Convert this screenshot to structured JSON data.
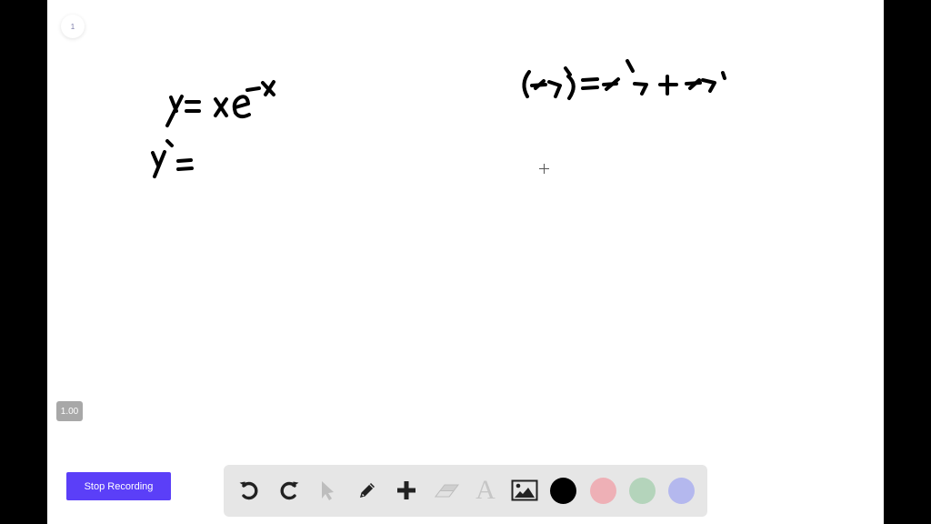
{
  "page": {
    "number": "1"
  },
  "zoom": {
    "level": "1.00"
  },
  "recording": {
    "stop_label": "Stop Recording"
  },
  "toolbar": {
    "tools": [
      {
        "name": "undo",
        "icon": "undo-icon",
        "enabled": true
      },
      {
        "name": "redo",
        "icon": "redo-icon",
        "enabled": true
      },
      {
        "name": "select",
        "icon": "cursor-arrow-icon",
        "enabled": false
      },
      {
        "name": "pen",
        "icon": "pencil-icon",
        "enabled": true
      },
      {
        "name": "add",
        "icon": "plus-icon",
        "enabled": true
      },
      {
        "name": "eraser",
        "icon": "eraser-icon",
        "enabled": false
      },
      {
        "name": "text",
        "icon": "text-icon",
        "label": "A",
        "enabled": false
      },
      {
        "name": "image",
        "icon": "image-icon",
        "enabled": true
      }
    ],
    "colors": [
      {
        "name": "black",
        "hex": "#000000",
        "selected": true
      },
      {
        "name": "pink",
        "hex": "#eeb0b6"
      },
      {
        "name": "green",
        "hex": "#b4d4bb"
      },
      {
        "name": "blue",
        "hex": "#b4b8ee"
      }
    ]
  },
  "handwriting": {
    "line1": "y = xe^(-x)",
    "line2": "y' =",
    "rule": "(fg)' = f'g + fg'"
  }
}
